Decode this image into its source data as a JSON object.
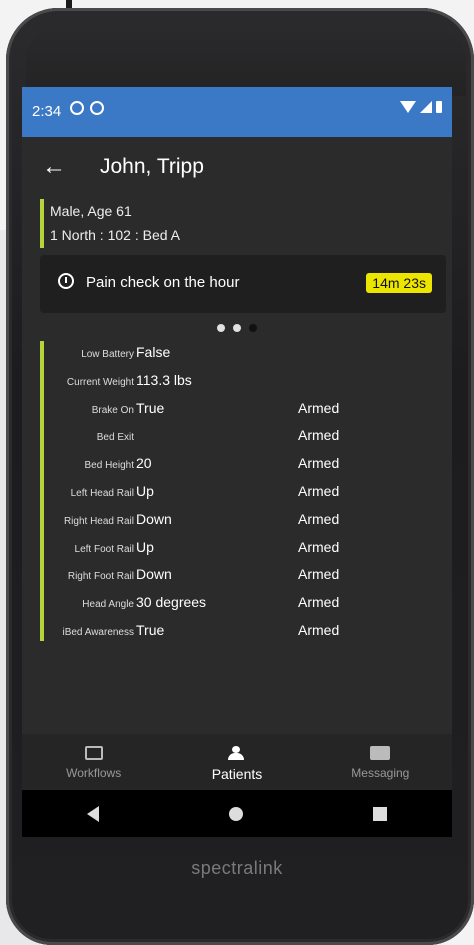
{
  "status": {
    "time": "2:34"
  },
  "appbar": {
    "title": "John, Tripp"
  },
  "patient": {
    "line1": "Male, Age 61",
    "line2": "1 North : 102 : Bed A"
  },
  "alert": {
    "text": "Pain check on the hour",
    "timer": "14m 23s"
  },
  "pager": {
    "count": 3,
    "active_index": 2
  },
  "rows": [
    {
      "label": "Low Battery",
      "value": "False",
      "armed": ""
    },
    {
      "label": "Current Weight",
      "value": "113.3 lbs",
      "armed": ""
    },
    {
      "label": "Brake On",
      "value": "True",
      "armed": "Armed"
    },
    {
      "label": "Bed Exit",
      "value": "",
      "armed": "Armed"
    },
    {
      "label": "Bed Height",
      "value": "20",
      "armed": "Armed"
    },
    {
      "label": "Left Head Rail",
      "value": "Up",
      "armed": "Armed"
    },
    {
      "label": "Right Head Rail",
      "value": "Down",
      "armed": "Armed"
    },
    {
      "label": "Left Foot Rail",
      "value": "Up",
      "armed": "Armed"
    },
    {
      "label": "Right Foot Rail",
      "value": "Down",
      "armed": "Armed"
    },
    {
      "label": "Head Angle",
      "value": "30 degrees",
      "armed": "Armed"
    },
    {
      "label": "iBed Awareness",
      "value": "True",
      "armed": "Armed"
    }
  ],
  "nav": {
    "workflows": "Workflows",
    "patients": "Patients",
    "messaging": "Messaging"
  },
  "device": {
    "brand": "spectralink"
  },
  "colors": {
    "statusbar": "#3b78c6",
    "accent_bar": "#b5d33a",
    "timer_badge": "#ece500"
  },
  "icons": {
    "back": "arrow-left-icon",
    "timer": "timer-icon",
    "workflows": "cast-icon",
    "patients": "person-alert-icon",
    "messaging": "contact-card-icon"
  }
}
